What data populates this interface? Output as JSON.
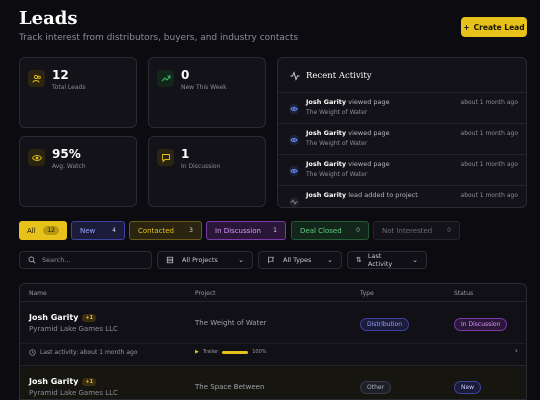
{
  "header": {
    "title": "Leads",
    "subtitle": "Track interest from distributors, buyers, and industry contacts",
    "create_label": "Create Lead"
  },
  "stats": [
    {
      "value": "12",
      "label": "Total Leads",
      "icon": "users-icon",
      "color": "#e6c21a"
    },
    {
      "value": "0",
      "label": "New This Week",
      "icon": "trending-up-icon",
      "color": "#3fbf6a"
    },
    {
      "value": "95%",
      "label": "Avg. Watch",
      "icon": "eye-icon",
      "color": "#e6c21a"
    },
    {
      "value": "1",
      "label": "In Discussion",
      "icon": "message-icon",
      "color": "#e6c21a"
    }
  ],
  "activity": {
    "title": "Recent Activity",
    "items": [
      {
        "name": "Josh Garity",
        "action": "viewed page",
        "project": "The Weight of Water",
        "time": "about 1 month ago",
        "icon": "eye-icon"
      },
      {
        "name": "Josh Garity",
        "action": "viewed page",
        "project": "The Weight of Water",
        "time": "about 1 month ago",
        "icon": "eye-icon"
      },
      {
        "name": "Josh Garity",
        "action": "viewed page",
        "project": "The Weight of Water",
        "time": "about 1 month ago",
        "icon": "eye-icon"
      },
      {
        "name": "Josh Garity",
        "action": "lead added to project",
        "project": "",
        "time": "about 1 month ago",
        "icon": "activity-icon"
      }
    ]
  },
  "filters": [
    {
      "label": "All",
      "count": "12"
    },
    {
      "label": "New",
      "count": "4"
    },
    {
      "label": "Contacted",
      "count": "3"
    },
    {
      "label": "In Discussion",
      "count": "1"
    },
    {
      "label": "Deal Closed",
      "count": "0"
    },
    {
      "label": "Not Interested",
      "count": "0"
    }
  ],
  "controls": {
    "search_placeholder": "Search...",
    "projects": "All Projects",
    "types": "All Types",
    "sort": "Last Activity"
  },
  "table": {
    "headers": [
      "Name",
      "Project",
      "Type",
      "Status"
    ],
    "rows": [
      {
        "name": "Josh Garity",
        "badge": "+1",
        "company": "Pyramid Lake Games LLC",
        "project": "The Weight of Water",
        "type": "Distribution",
        "status": "In Discussion",
        "last_activity": "Last activity: about 1 month ago",
        "media": "Trailer",
        "progress_text": "100%",
        "progress": 1.0
      },
      {
        "name": "Josh Garity",
        "badge": "+1",
        "company": "Pyramid Lake Games LLC",
        "project": "The Space Between",
        "type": "Other",
        "status": "New"
      }
    ]
  }
}
